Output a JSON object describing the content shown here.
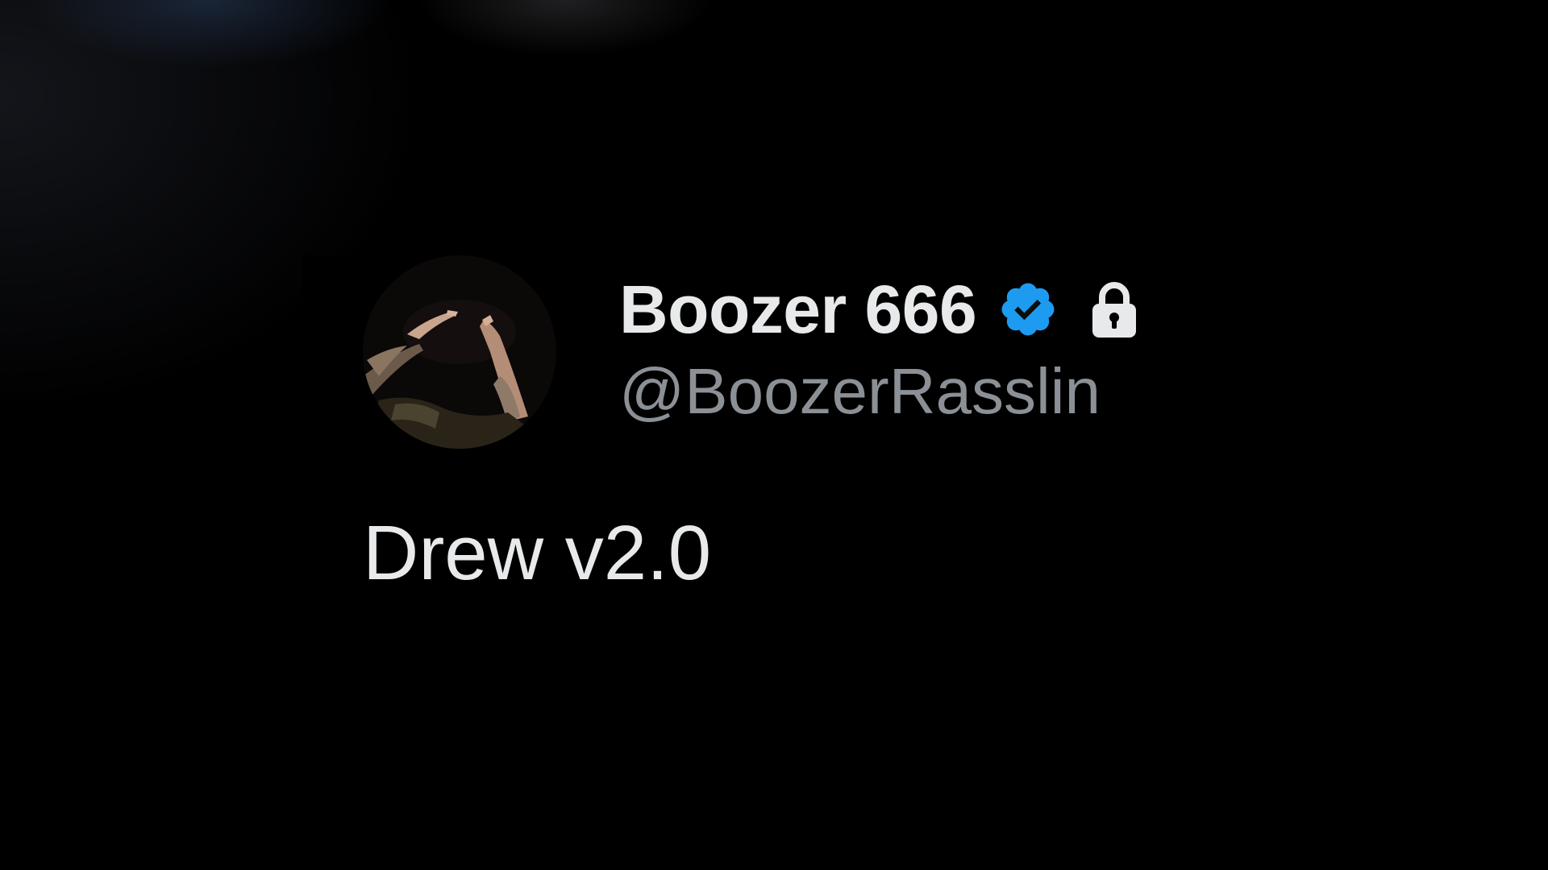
{
  "tweet": {
    "display_name": "Boozer 666",
    "handle": "@BoozerRasslin",
    "text": "Drew v2.0",
    "badges": {
      "verified_icon": "verified-badge-icon",
      "verified_color": "#1d9bf0",
      "lock_icon": "lock-icon",
      "lock_color": "#e7e9ea"
    },
    "avatar_icon": "profile-avatar"
  },
  "colors": {
    "background": "#000000",
    "primary_text": "#e7e9ea",
    "secondary_text": "#8b9096",
    "accent": "#1d9bf0"
  }
}
